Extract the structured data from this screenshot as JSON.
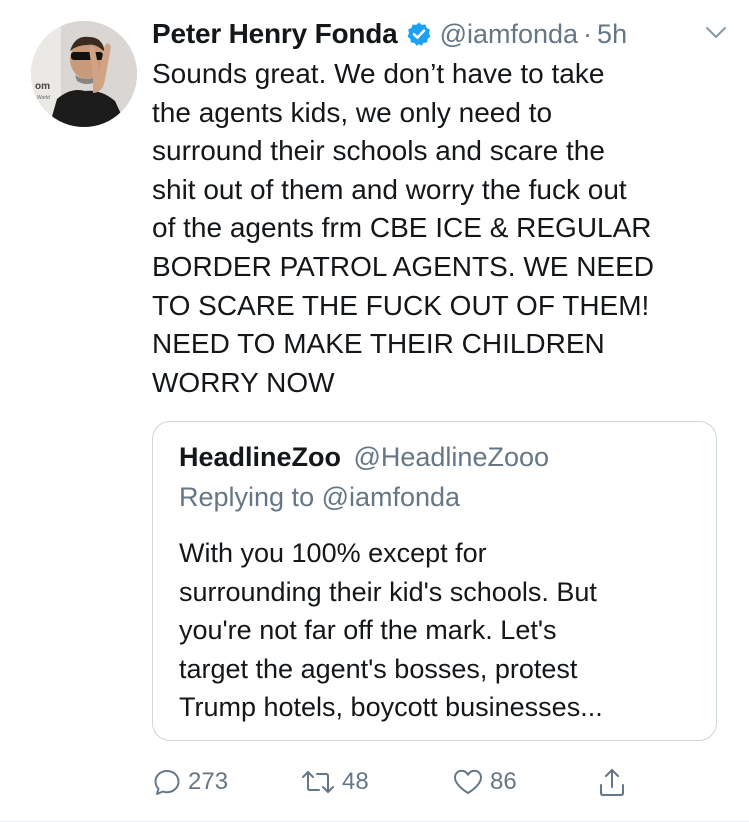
{
  "tweet": {
    "display_name": "Peter Henry Fonda",
    "handle": "@iamfonda",
    "separator": "·",
    "time": "5h",
    "text": "Sounds great. We don’t have to take\nthe agents kids, we only need to\nsurround their schools and scare the\nshit out of them and worry the fuck out\nof the agents frm CBE ICE & REGULAR\nBORDER PATROL AGENTS. WE NEED\nTO SCARE THE FUCK OUT OF THEM!\nNEED TO MAKE THEIR CHILDREN\nWORRY NOW",
    "verified": true,
    "avatar_backdrop_text": "om",
    "avatar_backdrop_subtext": "World"
  },
  "quoted_tweet": {
    "display_name": "HeadlineZoo",
    "handle": "@HeadlineZooo",
    "replying_to": "Replying to @iamfonda",
    "text": "With you 100% except for\nsurrounding their kid's schools. But\nyou're not far off the mark. Let's\ntarget the agent's bosses, protest\nTrump hotels, boycott businesses..."
  },
  "actions": {
    "reply_count": "273",
    "retweet_count": "48",
    "like_count": "86"
  },
  "icons": {
    "verified": "verified-badge-icon",
    "caret": "chevron-down-icon",
    "reply": "reply-icon",
    "retweet": "retweet-icon",
    "like": "heart-icon",
    "share": "share-icon"
  },
  "colors": {
    "verified_blue": "#1da1f2",
    "secondary_text": "#657786",
    "primary_text": "#14171a",
    "border": "#ccd6dd"
  }
}
